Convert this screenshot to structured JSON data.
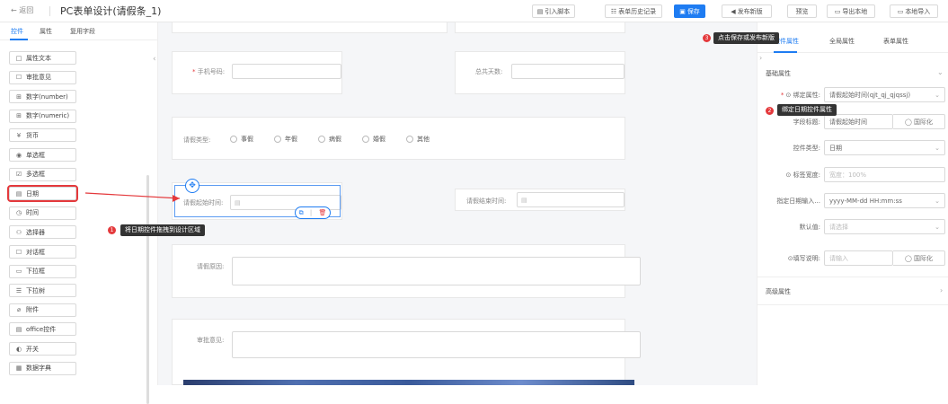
{
  "header": {
    "back_label": "← 返回",
    "title": "PC表单设计(请假条_1)",
    "buttons": {
      "import_script": "引入脚本",
      "history": "表单历史记录",
      "save": "保存",
      "publish": "发布新版",
      "preview": "预览",
      "export_local": "导出本地",
      "import_local": "本地导入"
    }
  },
  "left_panel": {
    "tabs": [
      "控件",
      "属性",
      "复用字段"
    ],
    "components": [
      {
        "icon": "□",
        "label": "属性文本"
      },
      {
        "icon": "☐",
        "label": "审批意见"
      },
      {
        "icon": "⊞",
        "label": "数字(number)"
      },
      {
        "icon": "⊞",
        "label": "数字(numeric)"
      },
      {
        "icon": "¥",
        "label": "货币"
      },
      {
        "icon": "◉",
        "label": "单选框"
      },
      {
        "icon": "☑",
        "label": "多选框"
      },
      {
        "icon": "▤",
        "label": "日期"
      },
      {
        "icon": "◷",
        "label": "时间"
      },
      {
        "icon": "⚇",
        "label": "选择器"
      },
      {
        "icon": "☐",
        "label": "对话框"
      },
      {
        "icon": "▭",
        "label": "下拉框"
      },
      {
        "icon": "☰",
        "label": "下拉树"
      },
      {
        "icon": "⌀",
        "label": "附件"
      },
      {
        "icon": "▤",
        "label": "office控件"
      },
      {
        "icon": "◐",
        "label": "开关"
      },
      {
        "icon": "▦",
        "label": "数据字典"
      }
    ]
  },
  "canvas": {
    "phone_label": "手机号码:",
    "total_days_label": "总共天数:",
    "leave_type_label": "请假类型:",
    "leave_types": [
      "事假",
      "年假",
      "病假",
      "婚假",
      "其他"
    ],
    "start_time_label": "请假起始时间:",
    "end_time_label": "请假结束时间:",
    "reason_label": "请假原因:",
    "approval_label": "审批意见:",
    "required_mark": "*"
  },
  "right_panel": {
    "tabs": [
      "控件属性",
      "全局属性",
      "表单属性"
    ],
    "basic_section": "基础属性",
    "advanced_section": "高级属性",
    "props": {
      "bind_label": "⊙ 绑定属性:",
      "bind_value": "请假起始时间(qjt_qj_qjqssj)",
      "field_title_label": "字段标题:",
      "field_title_value": "请假起始时间",
      "i18n_btn": "◯ 国际化",
      "control_type_label": "控件类型:",
      "control_type_value": "日期",
      "label_width_label": "⊙ 标签宽度:",
      "label_width_placeholder": "宽度：100%",
      "date_format_label": "指定日期输入...",
      "date_format_value": "yyyy-MM-dd HH:mm:ss",
      "default_label": "默认值:",
      "default_placeholder": "请选择",
      "help_label": "⊙填写说明:",
      "help_placeholder": "请输入"
    }
  },
  "annotations": {
    "step1": {
      "num": "1",
      "text": "将日期控件拖拽到设计区域"
    },
    "step2": {
      "num": "2",
      "text": "绑定日期控件属性"
    },
    "step3": {
      "num": "3",
      "text": "点击保存或发布新版"
    }
  },
  "colors": {
    "primary": "#1e7cf2",
    "annotation_red": "#e4393c"
  }
}
